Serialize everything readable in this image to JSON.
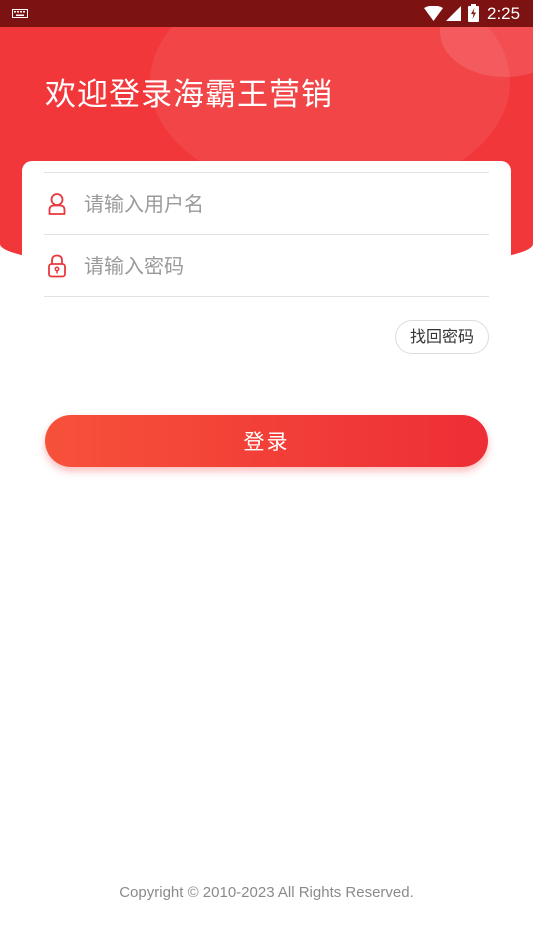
{
  "status_bar": {
    "time": "2:25",
    "icons": [
      "keyboard-icon",
      "wifi-icon",
      "signal-icon",
      "battery-charging-icon"
    ]
  },
  "header": {
    "welcome_text": "欢迎登录海霸王营销",
    "color": "#f2373b"
  },
  "form": {
    "username": {
      "placeholder": "请输入用户名",
      "value": "",
      "icon": "user-icon"
    },
    "password": {
      "placeholder": "请输入密码",
      "value": "",
      "icon": "lock-icon"
    },
    "forgot_password_label": "找回密码",
    "login_label": "登录"
  },
  "footer": {
    "copyright": "Copyright © 2010-2023  All Rights Reserved."
  },
  "colors": {
    "accent": "#ee2e36",
    "status_bar": "#7d1212",
    "icon": "#e8383d"
  }
}
